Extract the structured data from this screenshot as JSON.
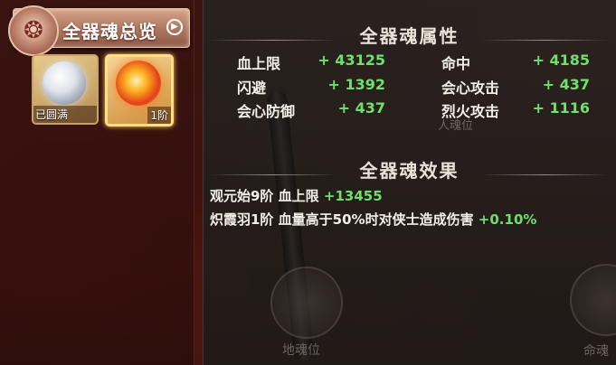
{
  "sidebar": {
    "title": "全器魂总览",
    "slots": [
      {
        "label": "已圆满",
        "kind": "silver-orb"
      },
      {
        "label": "1阶",
        "kind": "fire-orb",
        "selected": true
      }
    ]
  },
  "attributes": {
    "title": "全器魂属性",
    "stats": [
      {
        "name": "血上限",
        "value": "+ 43125"
      },
      {
        "name": "命中",
        "value": "+ 4185"
      },
      {
        "name": "闪避",
        "value": "+ 1392"
      },
      {
        "name": "会心攻击",
        "value": "+ 437"
      },
      {
        "name": "会心防御",
        "value": "+ 437"
      },
      {
        "name": "烈火攻击",
        "value": "+ 1116"
      }
    ]
  },
  "effects": {
    "title": "全器魂效果",
    "items": [
      {
        "text": "观元始9阶 血上限 ",
        "value": "+13455"
      },
      {
        "text": "炽霞羽1阶 血量高于50%时对侠士造成伤害 ",
        "value": "+0.10%"
      }
    ]
  },
  "background": {
    "slot_left_label": "地魂位",
    "slot_right_label": "命魂",
    "mid_faded_label": "人魂位"
  },
  "colors": {
    "value_green": "#6fe06a",
    "text_light": "#f3efe8",
    "title_tab": "#b07a63"
  }
}
